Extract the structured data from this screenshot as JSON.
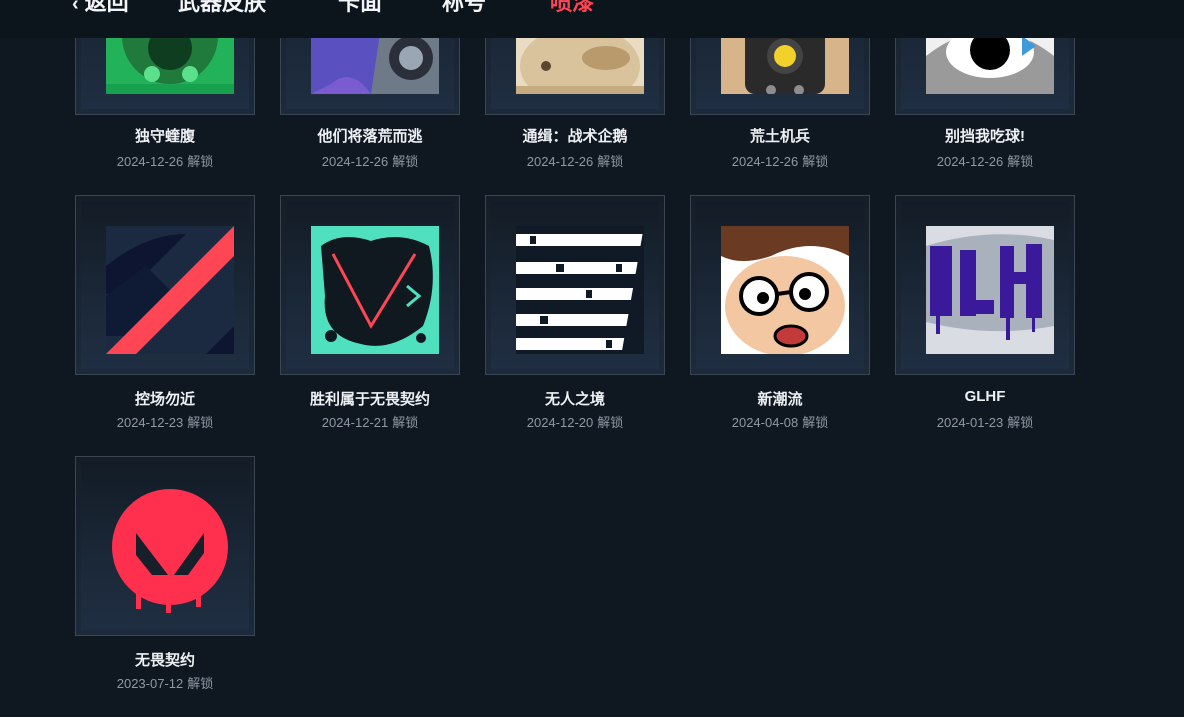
{
  "nav": {
    "back": "返回",
    "tabs": [
      {
        "label": "武器皮肤",
        "active": false
      },
      {
        "label": "卡面",
        "active": false
      },
      {
        "label": "称号",
        "active": false
      },
      {
        "label": "喷漆",
        "active": true
      }
    ],
    "active_color": "#ff4655"
  },
  "unlock_suffix": "解锁",
  "sprays": [
    {
      "name": "独守蝰腹",
      "date": "2024-12-26",
      "icon": "green-frog-spray-icon"
    },
    {
      "name": "他们将落荒而逃",
      "date": "2024-12-26",
      "icon": "purple-robot-spray-icon"
    },
    {
      "name": "通缉：战术企鹅",
      "date": "2024-12-26",
      "icon": "tactical-penguin-spray-icon"
    },
    {
      "name": "荒土机兵",
      "date": "2024-12-26",
      "icon": "wasteland-robot-spray-icon"
    },
    {
      "name": "别挡我吃球!",
      "date": "2024-12-26",
      "icon": "eye-spray-icon"
    },
    {
      "name": "控场勿近",
      "date": "2024-12-23",
      "icon": "chevron-stripe-spray-icon"
    },
    {
      "name": "胜利属于无畏契约",
      "date": "2024-12-21",
      "icon": "valorant-splatter-spray-icon"
    },
    {
      "name": "无人之境",
      "date": "2024-12-20",
      "icon": "unstoppable-text-spray-icon"
    },
    {
      "name": "新潮流",
      "date": "2024-04-08",
      "icon": "cartoon-face-spray-icon"
    },
    {
      "name": "GLHF",
      "date": "2024-01-23",
      "icon": "glhf-graffiti-spray-icon"
    },
    {
      "name": "无畏契约",
      "date": "2023-07-12",
      "icon": "valorant-logo-spray-icon"
    }
  ]
}
